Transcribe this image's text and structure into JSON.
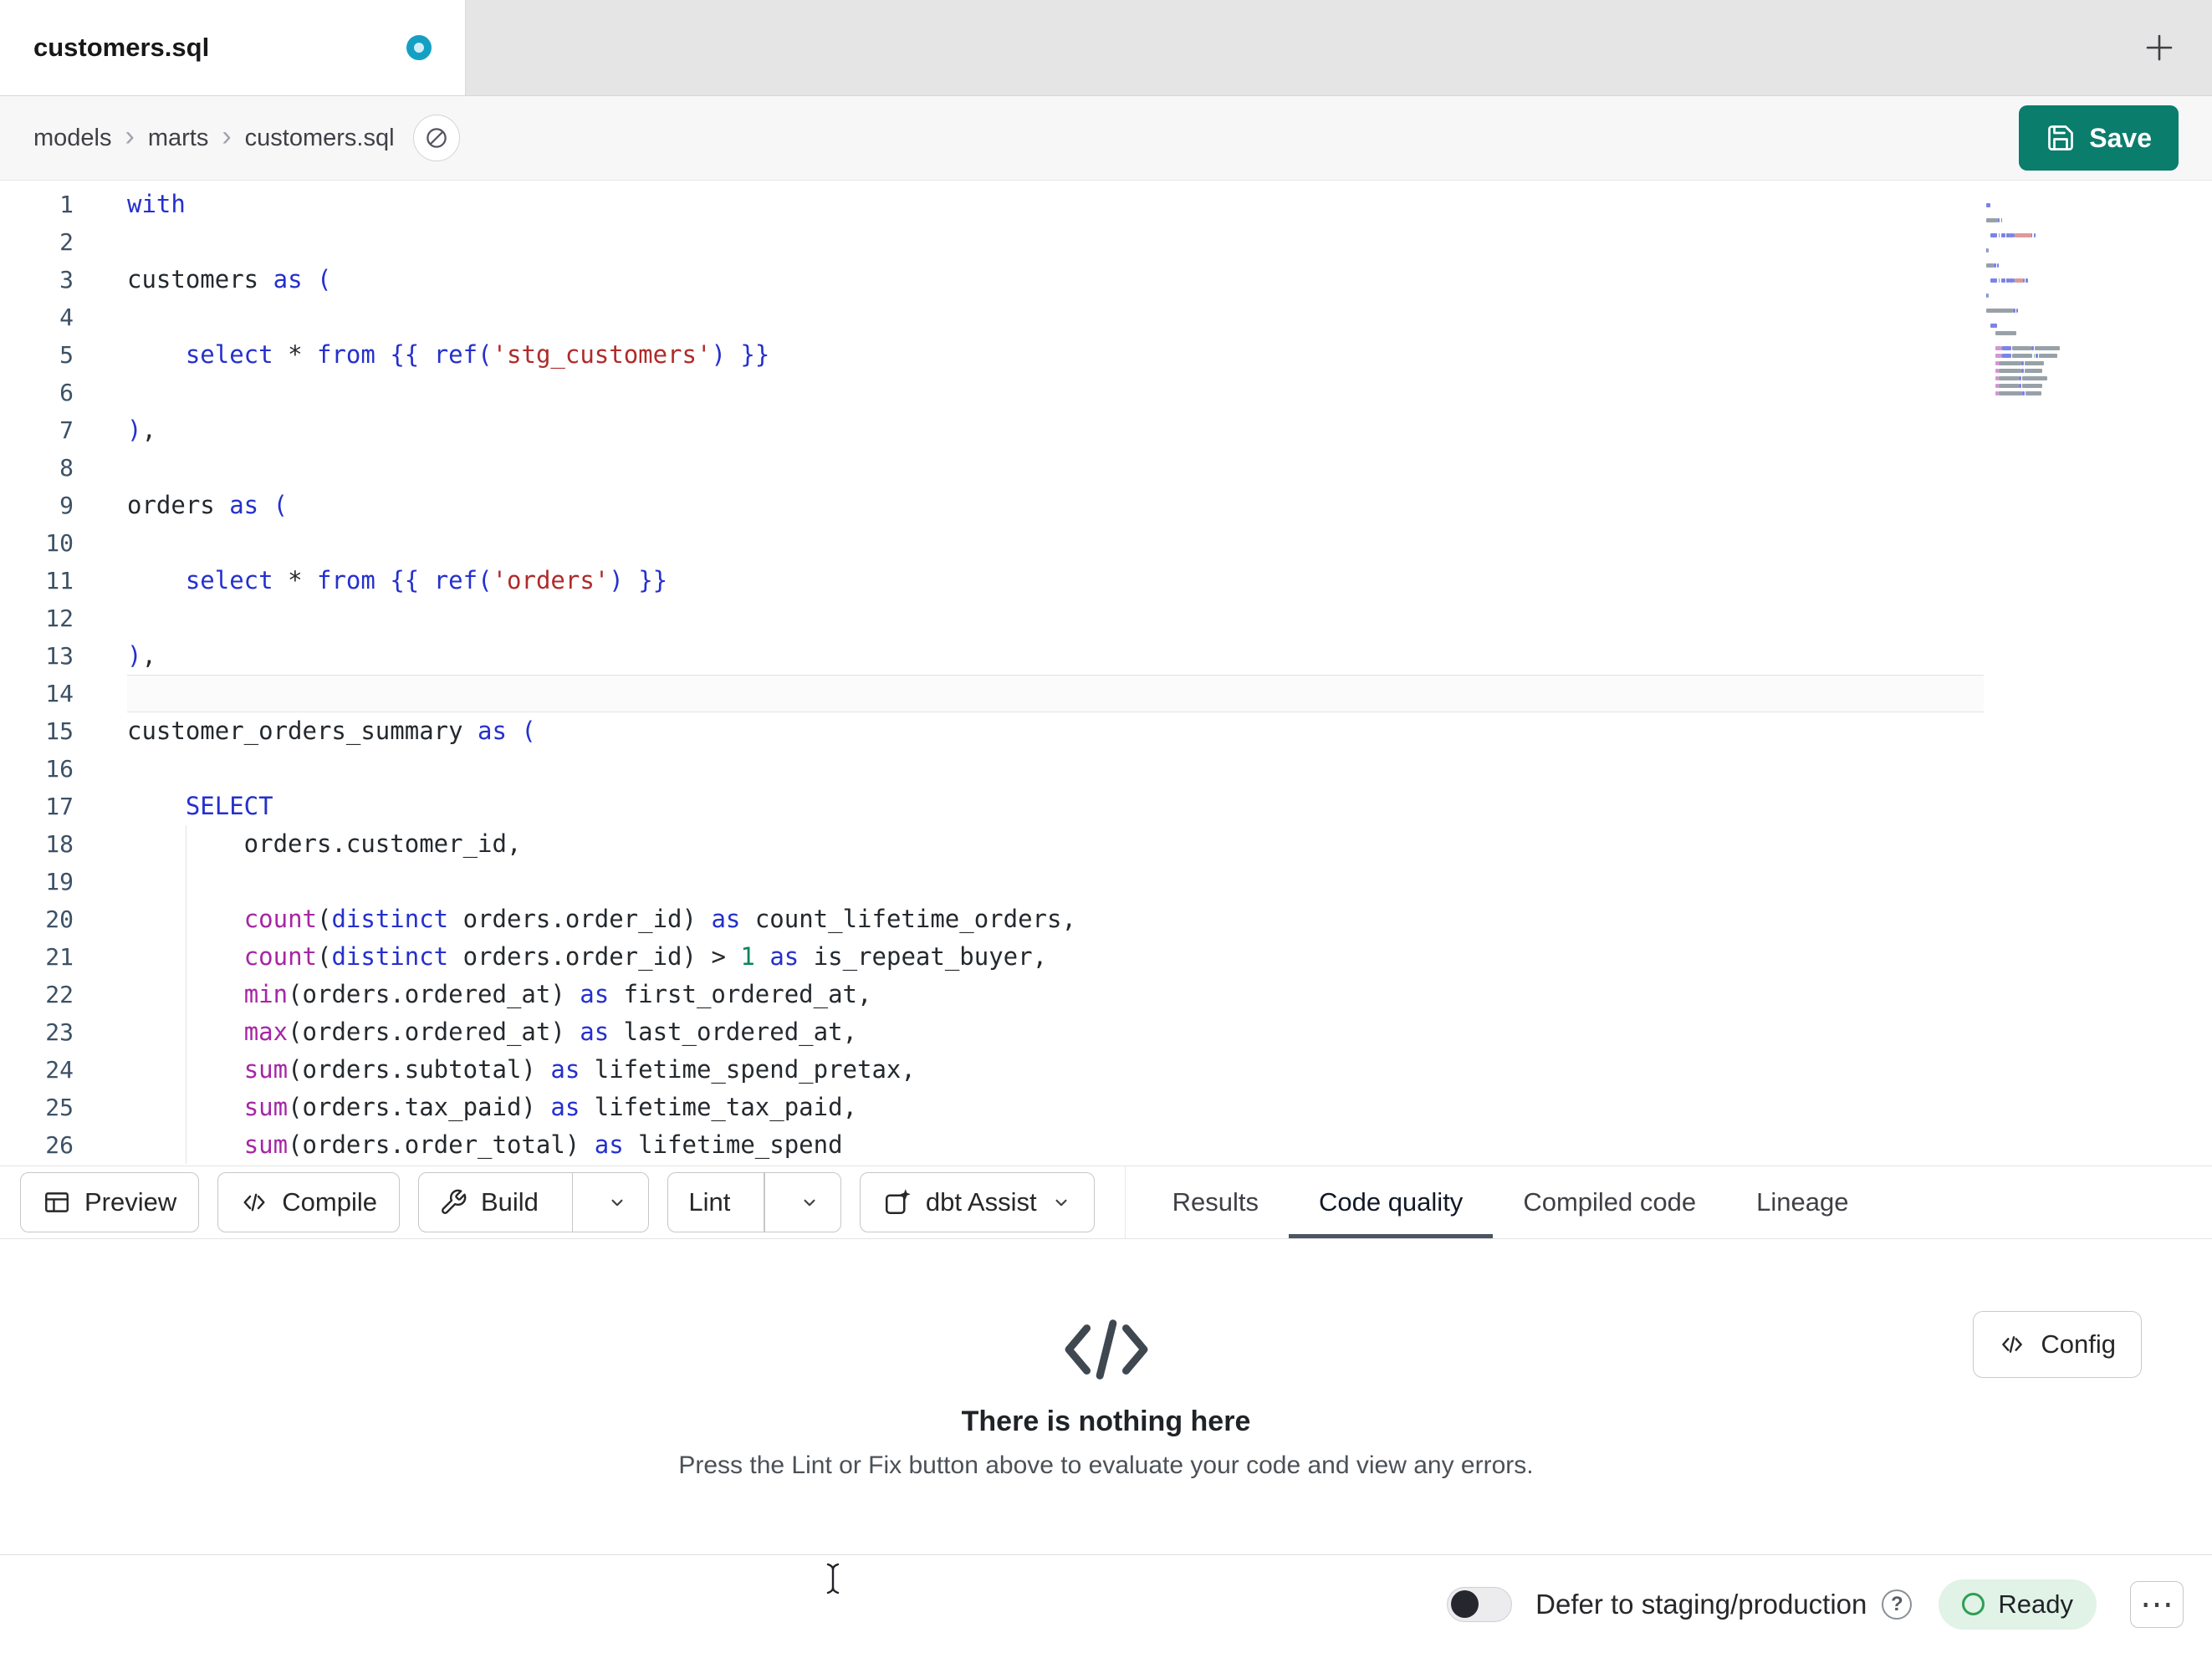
{
  "window": {
    "tab_title": "customers.sql",
    "modified": true
  },
  "breadcrumb": {
    "items": [
      "models",
      "marts",
      "customers.sql"
    ],
    "separator": "›"
  },
  "actions": {
    "save_label": "Save"
  },
  "editor": {
    "language": "sql",
    "active_line": 14,
    "lines": [
      {
        "t": [
          [
            "kw",
            "with"
          ]
        ]
      },
      {
        "t": []
      },
      {
        "t": [
          [
            "plain",
            "customers "
          ],
          [
            "kw",
            "as"
          ],
          [
            "plain",
            " "
          ],
          [
            "punct",
            "("
          ]
        ]
      },
      {
        "t": []
      },
      {
        "t": [
          [
            "plain",
            "    "
          ],
          [
            "kw",
            "select"
          ],
          [
            "plain",
            " "
          ],
          [
            "op",
            "*"
          ],
          [
            "plain",
            " "
          ],
          [
            "kw",
            "from"
          ],
          [
            "plain",
            " "
          ],
          [
            "punct",
            "{{ "
          ],
          [
            "kw",
            "ref"
          ],
          [
            "punct",
            "("
          ],
          [
            "str",
            "'stg_customers'"
          ],
          [
            "punct",
            ")"
          ],
          [
            "punct",
            " }}"
          ]
        ]
      },
      {
        "t": []
      },
      {
        "t": [
          [
            "punct",
            ")"
          ],
          [
            "plain",
            ","
          ]
        ]
      },
      {
        "t": []
      },
      {
        "t": [
          [
            "plain",
            "orders "
          ],
          [
            "kw",
            "as"
          ],
          [
            "plain",
            " "
          ],
          [
            "punct",
            "("
          ]
        ]
      },
      {
        "t": []
      },
      {
        "t": [
          [
            "plain",
            "    "
          ],
          [
            "kw",
            "select"
          ],
          [
            "plain",
            " "
          ],
          [
            "op",
            "*"
          ],
          [
            "plain",
            " "
          ],
          [
            "kw",
            "from"
          ],
          [
            "plain",
            " "
          ],
          [
            "punct",
            "{{ "
          ],
          [
            "kw",
            "ref"
          ],
          [
            "punct",
            "("
          ],
          [
            "str",
            "'orders'"
          ],
          [
            "punct",
            ")"
          ],
          [
            "punct",
            " }}"
          ]
        ]
      },
      {
        "t": []
      },
      {
        "t": [
          [
            "punct",
            ")"
          ],
          [
            "plain",
            ","
          ]
        ]
      },
      {
        "t": [],
        "active": true
      },
      {
        "t": [
          [
            "plain",
            "customer_orders_summary "
          ],
          [
            "kw",
            "as"
          ],
          [
            "plain",
            " "
          ],
          [
            "punct",
            "("
          ]
        ]
      },
      {
        "t": []
      },
      {
        "t": [
          [
            "plain",
            "    "
          ],
          [
            "kw",
            "SELECT"
          ]
        ]
      },
      {
        "t": [
          [
            "plain",
            "        orders.customer_id,"
          ]
        ],
        "guide": true
      },
      {
        "t": [],
        "guide": true
      },
      {
        "t": [
          [
            "plain",
            "        "
          ],
          [
            "fn",
            "count"
          ],
          [
            "plain",
            "("
          ],
          [
            "kw",
            "distinct"
          ],
          [
            "plain",
            " orders.order_id) "
          ],
          [
            "kw",
            "as"
          ],
          [
            "plain",
            " count_lifetime_orders,"
          ]
        ],
        "guide": true
      },
      {
        "t": [
          [
            "plain",
            "        "
          ],
          [
            "fn",
            "count"
          ],
          [
            "plain",
            "("
          ],
          [
            "kw",
            "distinct"
          ],
          [
            "plain",
            " orders.order_id) "
          ],
          [
            "op",
            ">"
          ],
          [
            "plain",
            " "
          ],
          [
            "num",
            "1"
          ],
          [
            "plain",
            " "
          ],
          [
            "kw",
            "as"
          ],
          [
            "plain",
            " is_repeat_buyer,"
          ]
        ],
        "guide": true
      },
      {
        "t": [
          [
            "plain",
            "        "
          ],
          [
            "fn",
            "min"
          ],
          [
            "plain",
            "(orders.ordered_at) "
          ],
          [
            "kw",
            "as"
          ],
          [
            "plain",
            " first_ordered_at,"
          ]
        ],
        "guide": true
      },
      {
        "t": [
          [
            "plain",
            "        "
          ],
          [
            "fn",
            "max"
          ],
          [
            "plain",
            "(orders.ordered_at) "
          ],
          [
            "kw",
            "as"
          ],
          [
            "plain",
            " last_ordered_at,"
          ]
        ],
        "guide": true
      },
      {
        "t": [
          [
            "plain",
            "        "
          ],
          [
            "fn",
            "sum"
          ],
          [
            "plain",
            "(orders.subtotal) "
          ],
          [
            "kw",
            "as"
          ],
          [
            "plain",
            " lifetime_spend_pretax,"
          ]
        ],
        "guide": true
      },
      {
        "t": [
          [
            "plain",
            "        "
          ],
          [
            "fn",
            "sum"
          ],
          [
            "plain",
            "(orders.tax_paid) "
          ],
          [
            "kw",
            "as"
          ],
          [
            "plain",
            " lifetime_tax_paid,"
          ]
        ],
        "guide": true
      },
      {
        "t": [
          [
            "plain",
            "        "
          ],
          [
            "fn",
            "sum"
          ],
          [
            "plain",
            "(orders.order_total) "
          ],
          [
            "kw",
            "as"
          ],
          [
            "plain",
            " lifetime_spend"
          ]
        ],
        "guide": true
      }
    ]
  },
  "toolbar": {
    "preview_label": "Preview",
    "compile_label": "Compile",
    "build_label": "Build",
    "lint_label": "Lint",
    "assist_label": "dbt Assist"
  },
  "tabs": [
    {
      "label": "Results",
      "active": false
    },
    {
      "label": "Code quality",
      "active": true
    },
    {
      "label": "Compiled code",
      "active": false
    },
    {
      "label": "Lineage",
      "active": false
    }
  ],
  "results_panel": {
    "empty_title": "There is nothing here",
    "empty_subtitle": "Press the Lint or Fix button above to evaluate your code and view any errors.",
    "config_label": "Config"
  },
  "statusbar": {
    "defer_label": "Defer to staging/production",
    "defer_enabled": false,
    "help_glyph": "?",
    "ready_label": "Ready",
    "menu_glyph": "⋯"
  },
  "icons": {
    "tab_indicator": "unsaved-dot",
    "new_tab": "plus",
    "breadcrumb_action": "slashed-circle",
    "save": "floppy-disk",
    "preview": "table",
    "compile": "code-brackets",
    "build": "wrench",
    "assist": "sparkle-box",
    "dropdowns": "chevron-down",
    "empty_state": "code-brackets",
    "config": "code-brackets",
    "help": "question-circle",
    "ready": "circle-outline",
    "menu": "ellipsis"
  },
  "colors": {
    "accent": "#0a7d6d",
    "indicator": "#14a0c4",
    "kw": "#2430cd",
    "str": "#b02a2a",
    "fn": "#a626a4",
    "num": "#098658",
    "plain": "#24292e",
    "linenum": "#3c5166",
    "ready-bg": "#e1f2e6",
    "ready-icon": "#2f9e54",
    "underline": "#4b5563"
  }
}
